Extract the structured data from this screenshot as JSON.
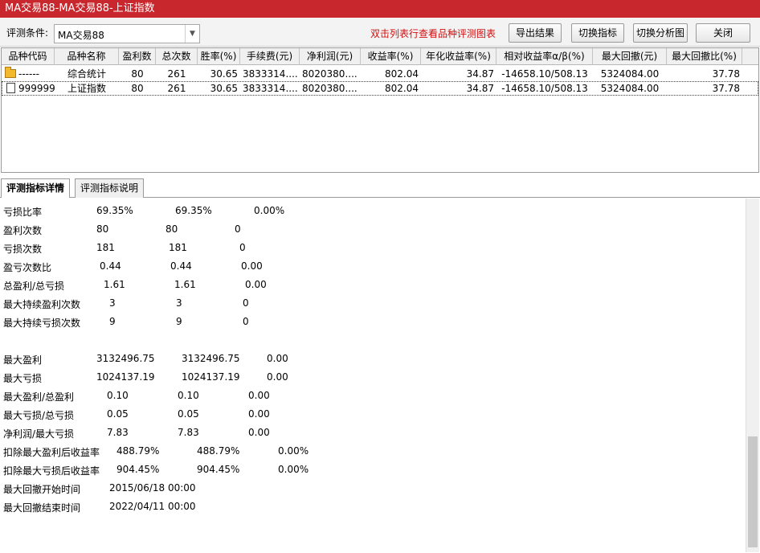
{
  "window": {
    "title": "MA交易88-MA交易88-上证指数"
  },
  "toolbar": {
    "condition_label": "评测条件:",
    "condition_value": "MA交易88",
    "hint": "双击列表行查看品种评测图表",
    "export_label": "导出结果",
    "switch_indicator_label": "切换指标",
    "switch_chart_label": "切换分析图",
    "close_label": "关闭"
  },
  "table": {
    "headers": [
      "品种代码",
      "品种名称",
      "盈利数",
      "总次数",
      "胜率(%)",
      "手续费(元)",
      "净利润(元)",
      "收益率(%)",
      "年化收益率(%)",
      "相对收益率α/β(%)",
      "最大回撤(元)",
      "最大回撤比(%)"
    ],
    "rows": [
      [
        "------",
        "综合统计",
        "80",
        "261",
        "30.65",
        "3833314....",
        "8020380....",
        "802.04",
        "34.87",
        "-14658.10/508.13",
        "5324084.00",
        "37.78"
      ],
      [
        "999999",
        "上证指数",
        "80",
        "261",
        "30.65",
        "3833314....",
        "8020380....",
        "802.04",
        "34.87",
        "-14658.10/508.13",
        "5324084.00",
        "37.78"
      ]
    ]
  },
  "tabs": {
    "detail": "评测指标详情",
    "explain": "评测指标说明"
  },
  "details": [
    [
      "亏损比率",
      "69.35%",
      "69.35%",
      "0.00%"
    ],
    [
      "盈利次数",
      "80",
      "80",
      "0"
    ],
    [
      "亏损次数",
      "181",
      "181",
      "0"
    ],
    [
      "盈亏次数比",
      "0.44",
      "0.44",
      "0.00"
    ],
    [
      "总盈利/总亏损",
      "1.61",
      "1.61",
      "0.00"
    ],
    [
      "最大持续盈利次数",
      "3",
      "3",
      "0"
    ],
    [
      "最大持续亏损次数",
      "9",
      "9",
      "0"
    ],
    [
      "最大盈利",
      "3132496.75",
      "3132496.75",
      "0.00"
    ],
    [
      "最大亏损",
      "1024137.19",
      "1024137.19",
      "0.00"
    ],
    [
      "最大盈利/总盈利",
      "0.10",
      "0.10",
      "0.00"
    ],
    [
      "最大亏损/总亏损",
      "0.05",
      "0.05",
      "0.00"
    ],
    [
      "净利润/最大亏损",
      "7.83",
      "7.83",
      "0.00"
    ],
    [
      "扣除最大盈利后收益率",
      "488.79%",
      "488.79%",
      "0.00%"
    ],
    [
      "扣除最大亏损后收益率",
      "904.45%",
      "904.45%",
      "0.00%"
    ],
    [
      "最大回撤开始时间",
      "2015/06/18 00:00"
    ],
    [
      "最大回撤结束时间",
      "2022/04/11 00:00"
    ]
  ]
}
